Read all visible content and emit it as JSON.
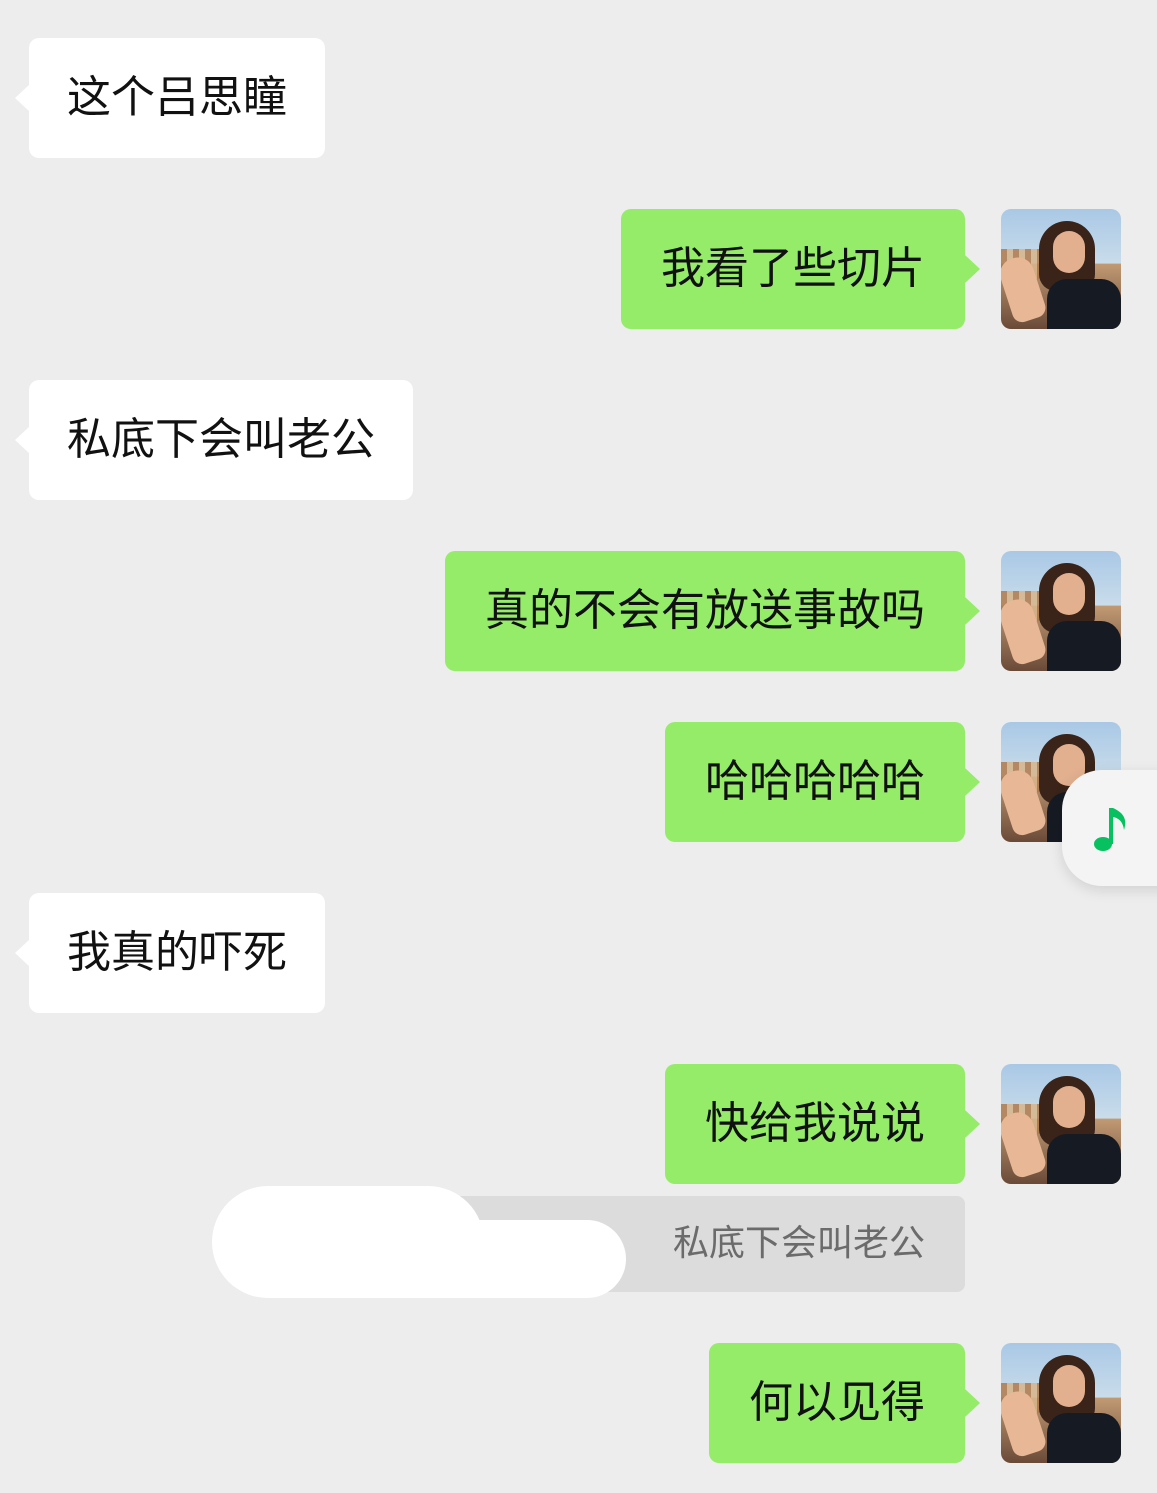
{
  "messages": [
    {
      "side": "in",
      "text": "这个吕思瞳"
    },
    {
      "side": "out",
      "text": "我看了些切片"
    },
    {
      "side": "in",
      "text": "私底下会叫老公"
    },
    {
      "side": "out",
      "text": "真的不会有放送事故吗"
    },
    {
      "side": "out",
      "text": "哈哈哈哈哈"
    },
    {
      "side": "in",
      "text": "我真的吓死"
    },
    {
      "side": "out",
      "text": "快给我说说"
    },
    {
      "side": "out",
      "text": "何以见得"
    }
  ],
  "quote": {
    "text": "私底下会叫老公"
  },
  "colors": {
    "background": "#ededed",
    "incoming_bubble": "#ffffff",
    "outgoing_bubble": "#95ec69",
    "quote_bg": "#dcdcdc",
    "music_icon": "#07c160"
  },
  "icons": {
    "avatar": "user-avatar-photo",
    "music": "music-note-icon"
  }
}
